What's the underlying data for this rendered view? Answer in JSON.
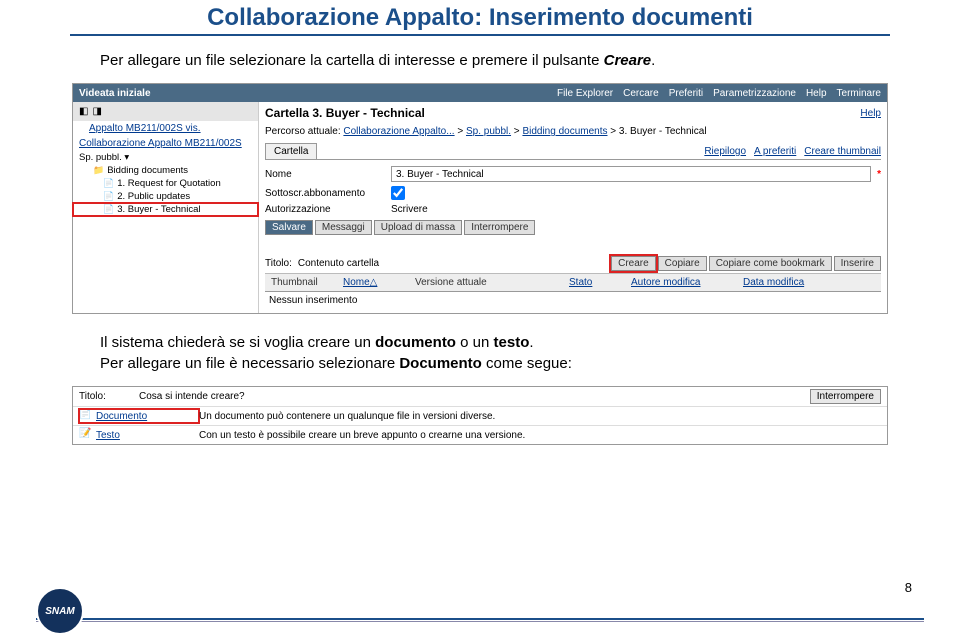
{
  "page": {
    "title": "Collaborazione Appalto: Inserimento documenti",
    "number": "8"
  },
  "intro": {
    "pre": "Per allegare un file selezionare la cartella di interesse e premere il pulsante ",
    "keyword": "Creare",
    "post": "."
  },
  "topbar": {
    "left": "Videata iniziale",
    "menu": [
      "File Explorer",
      "Cercare",
      "Preferiti",
      "Parametrizzazione",
      "Help",
      "Terminare"
    ]
  },
  "sidebar": {
    "head_icons": [
      "◧",
      "◨"
    ],
    "link1": "Appalto MB211/002S vis.",
    "link2": "Collaborazione Appalto MB211/002S",
    "sp": "Sp. pubbl. ▾",
    "tree": [
      {
        "label": "Bidding documents",
        "cls": "folder-icon",
        "lv": 1
      },
      {
        "label": "1. Request for Quotation",
        "cls": "doc-icon",
        "lv": 2
      },
      {
        "label": "2. Public updates",
        "cls": "doc-icon",
        "lv": 2
      },
      {
        "label": "3. Buyer - Technical",
        "cls": "doc-icon",
        "lv": 2,
        "hl": true
      }
    ]
  },
  "content": {
    "title": "Cartella 3. Buyer - Technical",
    "help": "Help",
    "bc_label": "Percorso attuale:",
    "bc1": "Collaborazione Appalto...",
    "bc2": "Sp. pubbl.",
    "bc3": "Bidding documents",
    "bc4": "3. Buyer - Technical",
    "tab": "Cartella",
    "right_links": [
      "Riepilogo",
      "A preferiti",
      "Creare thumbnail"
    ],
    "form": {
      "nome_lbl": "Nome",
      "nome_val": "3. Buyer - Technical",
      "sotto_lbl": "Sottoscr.abbonamento",
      "auth_lbl": "Autorizzazione",
      "auth_val": "Scrivere"
    },
    "buttons": [
      "Salvare",
      "Messaggi",
      "Upload di massa",
      "Interrompere"
    ],
    "section2": {
      "title_lbl": "Titolo:",
      "title_val": "Contenuto cartella",
      "actions": [
        "Creare",
        "Copiare",
        "Copiare come bookmark",
        "Inserire"
      ],
      "cols": [
        "Thumbnail",
        "Nome△",
        "Versione attuale",
        "",
        "Stato",
        "Autore modifica",
        "Data modifica"
      ],
      "msg": "Nessun inserimento"
    }
  },
  "mid": {
    "line1a": "Il sistema chiederà se si voglia creare un ",
    "line1b": "documento",
    "line1c": " o un ",
    "line1d": "testo",
    "line1e": ".",
    "line2a": "Per allegare un file è necessario selezionare ",
    "line2b": "Documento",
    "line2c": " come segue:"
  },
  "s2": {
    "row1_lbl": "Titolo:",
    "row1_val": "Cosa si intende creare?",
    "row1_btn": "Interrompere",
    "row2_link": "Documento",
    "row2_desc": "Un documento può contenere un qualunque file in versioni diverse.",
    "row3_link": "Testo",
    "row3_desc": "Con un testo è possibile creare un breve appunto o crearne una versione."
  },
  "logo_text": "SNAM"
}
